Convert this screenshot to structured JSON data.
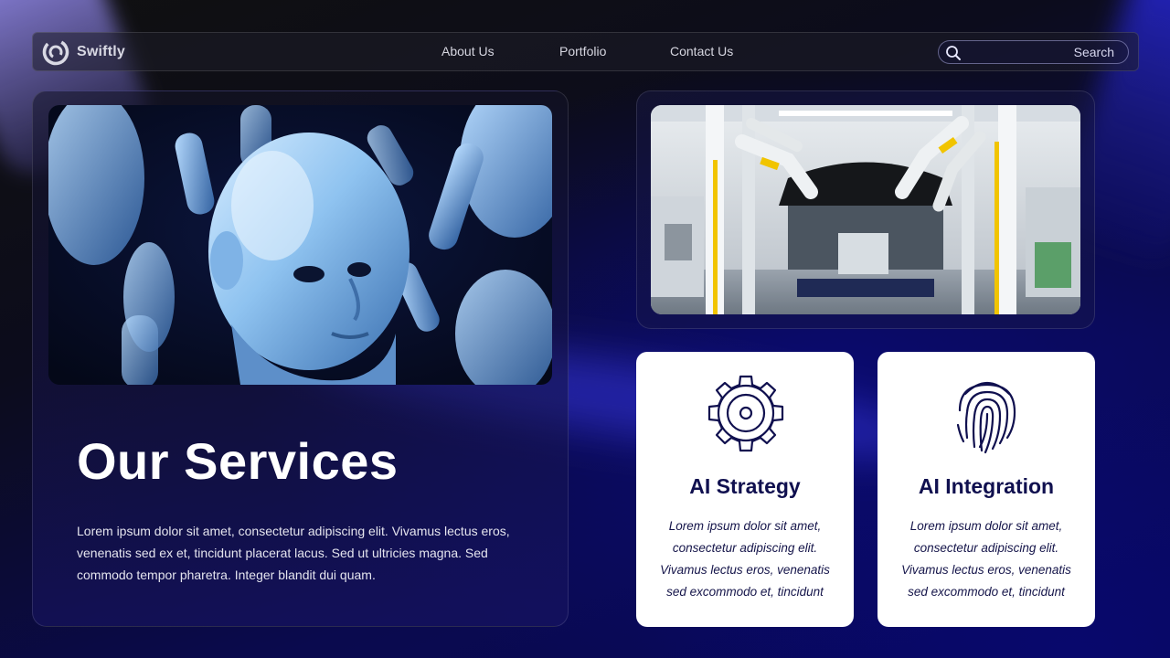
{
  "brand": {
    "name": "Swiftly"
  },
  "nav": {
    "links": [
      {
        "label": "About Us"
      },
      {
        "label": "Portfolio"
      },
      {
        "label": "Contact Us"
      }
    ],
    "search": {
      "placeholder": "Search"
    }
  },
  "hero": {
    "title": "Our Services",
    "description": "Lorem ipsum dolor sit amet, consectetur adipiscing elit. Vivamus lectus eros, venenatis sed ex et, tincidunt placerat lacus. Sed ut ultricies magna. Sed commodo tempor pharetra. Integer blandit dui quam."
  },
  "services": [
    {
      "title": "AI Strategy",
      "icon": "gear-icon",
      "text": "Lorem ipsum dolor sit amet, consectetur adipiscing elit. Vivamus lectus eros, venenatis sed excommodo et, tincidunt"
    },
    {
      "title": "AI Integration",
      "icon": "fingerprint-icon",
      "text": "Lorem ipsum dolor sit amet, consectetur adipiscing elit. Vivamus lectus eros, venenatis sed excommodo et, tincidunt"
    }
  ],
  "colors": {
    "accent_navy": "#10104f",
    "background_deep_blue": "#07075a",
    "card_white": "#ffffff"
  }
}
